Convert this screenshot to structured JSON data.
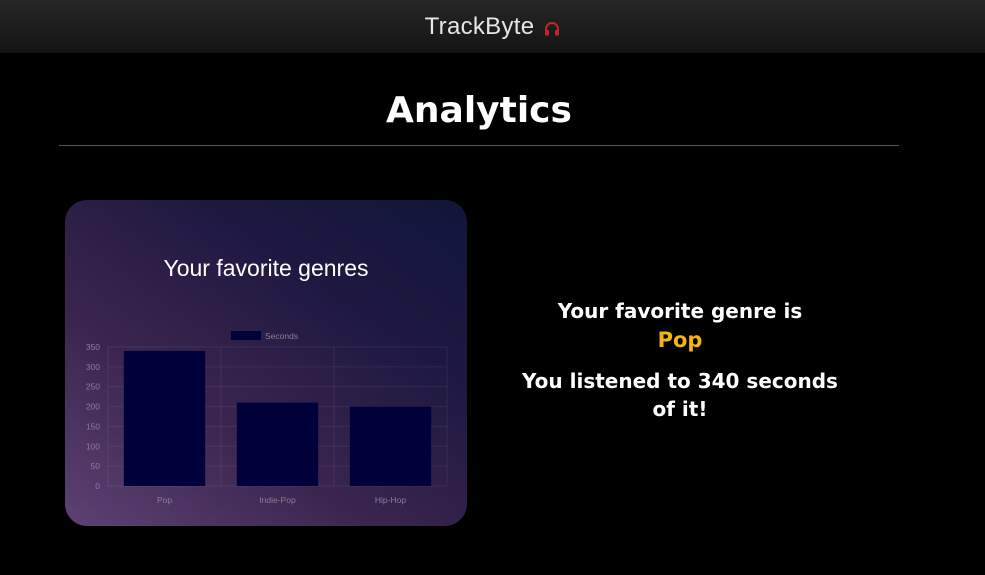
{
  "header": {
    "brand": "TrackByte",
    "brand_icon": "headphones-icon",
    "brand_icon_color": "#c8232c"
  },
  "page": {
    "title": "Analytics"
  },
  "card": {
    "title": "Your favorite genres"
  },
  "summary": {
    "favorite_label": "Your favorite genre is",
    "favorite_genre": "Pop",
    "listened_text": "You listened to 340 seconds of it!"
  },
  "colors": {
    "accent": "#f5b414",
    "bar": "#00003a"
  },
  "chart_data": {
    "type": "bar",
    "categories": [
      "Pop",
      "Indie-Pop",
      "Hip-Hop"
    ],
    "series": [
      {
        "name": "Seconds",
        "values": [
          340,
          210,
          200
        ]
      }
    ],
    "yticks": [
      0,
      50,
      100,
      150,
      200,
      250,
      300,
      350
    ],
    "ylim": [
      0,
      350
    ],
    "grid": true,
    "legend": "top"
  }
}
